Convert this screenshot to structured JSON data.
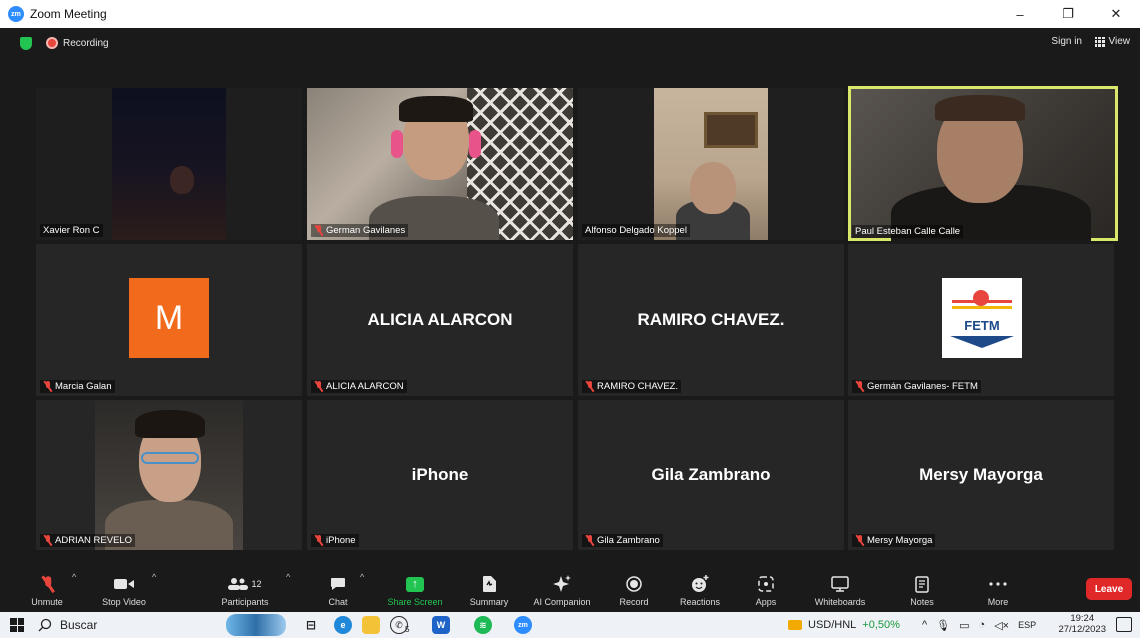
{
  "window": {
    "title": "Zoom Meeting",
    "app_icon": "zm",
    "minimize": "–",
    "restore": "❐",
    "close": "✕"
  },
  "topbar": {
    "recording_label": "Recording",
    "sign_in": "Sign in",
    "view_label": "View"
  },
  "participants": [
    {
      "name": "Xavier Ron C",
      "muted": false,
      "type": "video"
    },
    {
      "name": "German Gavilanes",
      "muted": true,
      "type": "video"
    },
    {
      "name": "Alfonso Delgado Koppel",
      "muted": false,
      "type": "video"
    },
    {
      "name": "Paul Esteban Calle Calle",
      "muted": false,
      "type": "video",
      "active_speaker": true
    },
    {
      "name": "Marcia Galan",
      "muted": true,
      "type": "avatar",
      "avatar_letter": "M",
      "avatar_color": "#f26a1b"
    },
    {
      "name": "ALICIA ALARCON",
      "muted": true,
      "type": "name",
      "display": "ALICIA ALARCON"
    },
    {
      "name": "RAMIRO CHAVEZ.",
      "muted": true,
      "type": "name",
      "display": "RAMIRO CHAVEZ."
    },
    {
      "name": "Germán Gavilanes- FETM",
      "muted": true,
      "type": "logo",
      "logo_text": "FETM"
    },
    {
      "name": "ADRIAN REVELO",
      "muted": true,
      "type": "video"
    },
    {
      "name": "iPhone",
      "muted": true,
      "type": "name",
      "display": "iPhone"
    },
    {
      "name": "Gila Zambrano",
      "muted": true,
      "type": "name",
      "display": "Gila Zambrano"
    },
    {
      "name": "Mersy Mayorga",
      "muted": true,
      "type": "name",
      "display": "Mersy Mayorga"
    }
  ],
  "toolbar": {
    "unmute": "Unmute",
    "stop_video": "Stop Video",
    "participants": "Participants",
    "participants_count": "12",
    "chat": "Chat",
    "share_screen": "Share Screen",
    "summary": "Summary",
    "ai_companion": "AI Companion",
    "record": "Record",
    "reactions": "Reactions",
    "apps": "Apps",
    "whiteboards": "Whiteboards",
    "notes": "Notes",
    "more": "More",
    "leave": "Leave"
  },
  "taskbar": {
    "search_placeholder": "Buscar",
    "whatsapp_badge": "5",
    "zoom_label": "zm",
    "currency": "USD/HNL",
    "currency_change": "+0,50%",
    "language": "ESP",
    "time": "19:24",
    "date": "27/12/2023"
  },
  "colors": {
    "accent_green": "#23c552",
    "leave_red": "#e02828",
    "speaker_outline": "#d9e86b",
    "tile_bg": "#262626",
    "muted_red": "#e8453c"
  }
}
